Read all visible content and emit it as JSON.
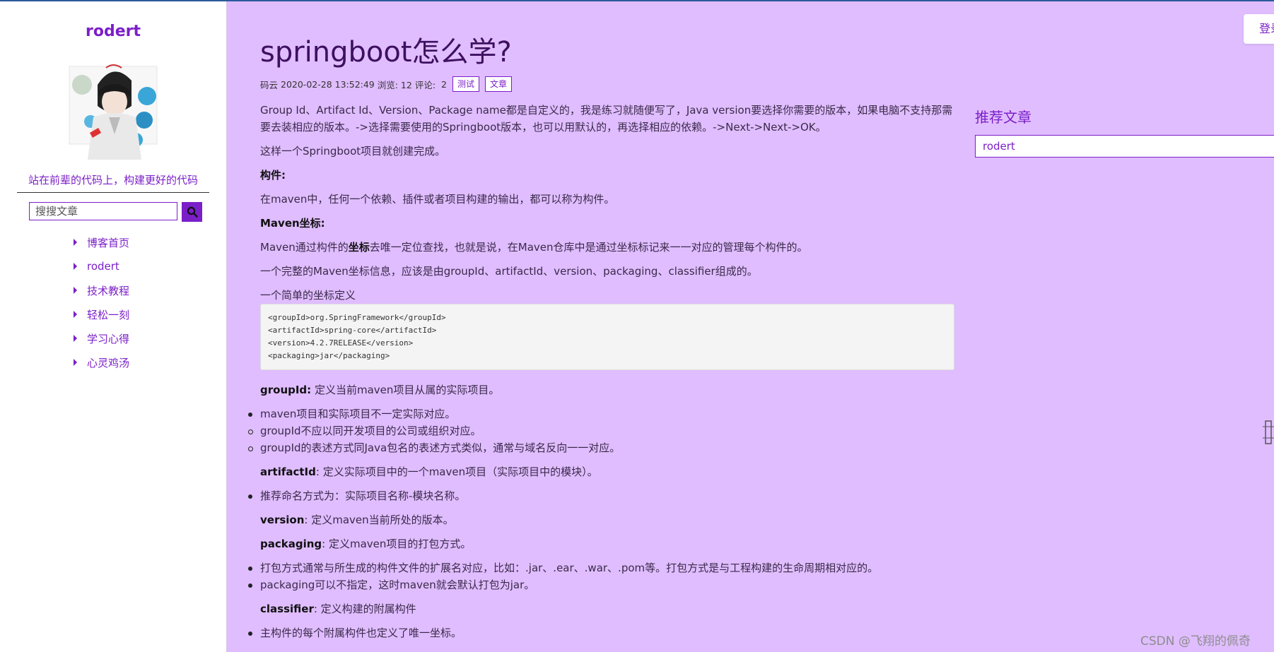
{
  "sidebar": {
    "site_title": "rodert",
    "slogan": "站在前辈的代码上，构建更好的代码",
    "search": {
      "placeholder": "搜搜文章"
    },
    "nav": [
      {
        "label": "博客首页"
      },
      {
        "label": "rodert"
      },
      {
        "label": "技术教程"
      },
      {
        "label": "轻松一刻"
      },
      {
        "label": "学习心得"
      },
      {
        "label": "心灵鸡汤"
      }
    ]
  },
  "header": {
    "login_label": "登录"
  },
  "article": {
    "title": "springboot怎么学?",
    "meta": {
      "author": "码云",
      "date": "2020-02-28 13:52:49",
      "views": "浏览: 12",
      "comments": "评论:",
      "comment_count": "2",
      "tags": [
        "测试",
        "文章"
      ]
    },
    "p1": "Group Id、Artifact Id、Version、Package name都是自定义的，我是练习就随便写了，Java version要选择你需要的版本，如果电脑不支持那需要去装相应的版本。->选择需要使用的Springboot版本，也可以用默认的，再选择相应的依赖。->Next->Next->OK。",
    "p2": "这样一个Springboot项目就创建完成。",
    "h_component": "构件:",
    "p3": "在maven中，任何一个依赖、插件或者项目构建的输出，都可以称为构件。",
    "h_maven": "Maven坐标:",
    "p4_a": "Maven通过构件的",
    "p4_b": "坐标",
    "p4_c": "去唯一定位查找，也就是说，在Maven仓库中是通过坐标标记来一一对应的管理每个构件的。",
    "p5": "一个完整的Maven坐标信息，应该是由groupId、artifactId、version、packaging、classifier组成的。",
    "p6": "一个简单的坐标定义",
    "code": "<groupId>org.SpringFramework</groupId>\n<artifactId>spring-core</artifactId>\n<version>4.2.7RELEASE</version>\n<packaging>jar</packaging>",
    "groupid_label": "groupId:",
    "groupid_text": " 定义当前maven项目从属的实际项目。",
    "groupid_items": [
      "maven项目和实际项目不一定实际对应。",
      "groupId不应以同开发项目的公司或组织对应。",
      "groupId的表述方式同Java包名的表述方式类似，通常与域名反向一一对应。"
    ],
    "artifactid_label": "artifactId",
    "artifactid_text": ": 定义实际项目中的一个maven项目（实际项目中的模块）。",
    "artifactid_items": [
      "推荐命名方式为：实际项目名称-模块名称。"
    ],
    "version_label": "version",
    "version_text": ": 定义maven当前所处的版本。",
    "packaging_label": "packaging",
    "packaging_text": ": 定义maven项目的打包方式。",
    "packaging_items": [
      "打包方式通常与所生成的构件文件的扩展名对应，比如：.jar、.ear、.war、.pom等。打包方式是与工程构建的生命周期相对应的。",
      "packaging可以不指定，这时maven就会默认打包为jar。"
    ],
    "classifier_label": "classifier",
    "classifier_text": ": 定义构建的附属构件",
    "classifier_items": [
      "主构件的每个附属构件也定义了唯一坐标。"
    ]
  },
  "recommend": {
    "title": "推荐文章",
    "items": [
      "rodert"
    ]
  },
  "watermark": "CSDN @飞翔的佩奇",
  "colors": {
    "accent": "#7b1fc8",
    "page_bg": "#e0bdff",
    "sidebar_bg": "#ffffff"
  }
}
